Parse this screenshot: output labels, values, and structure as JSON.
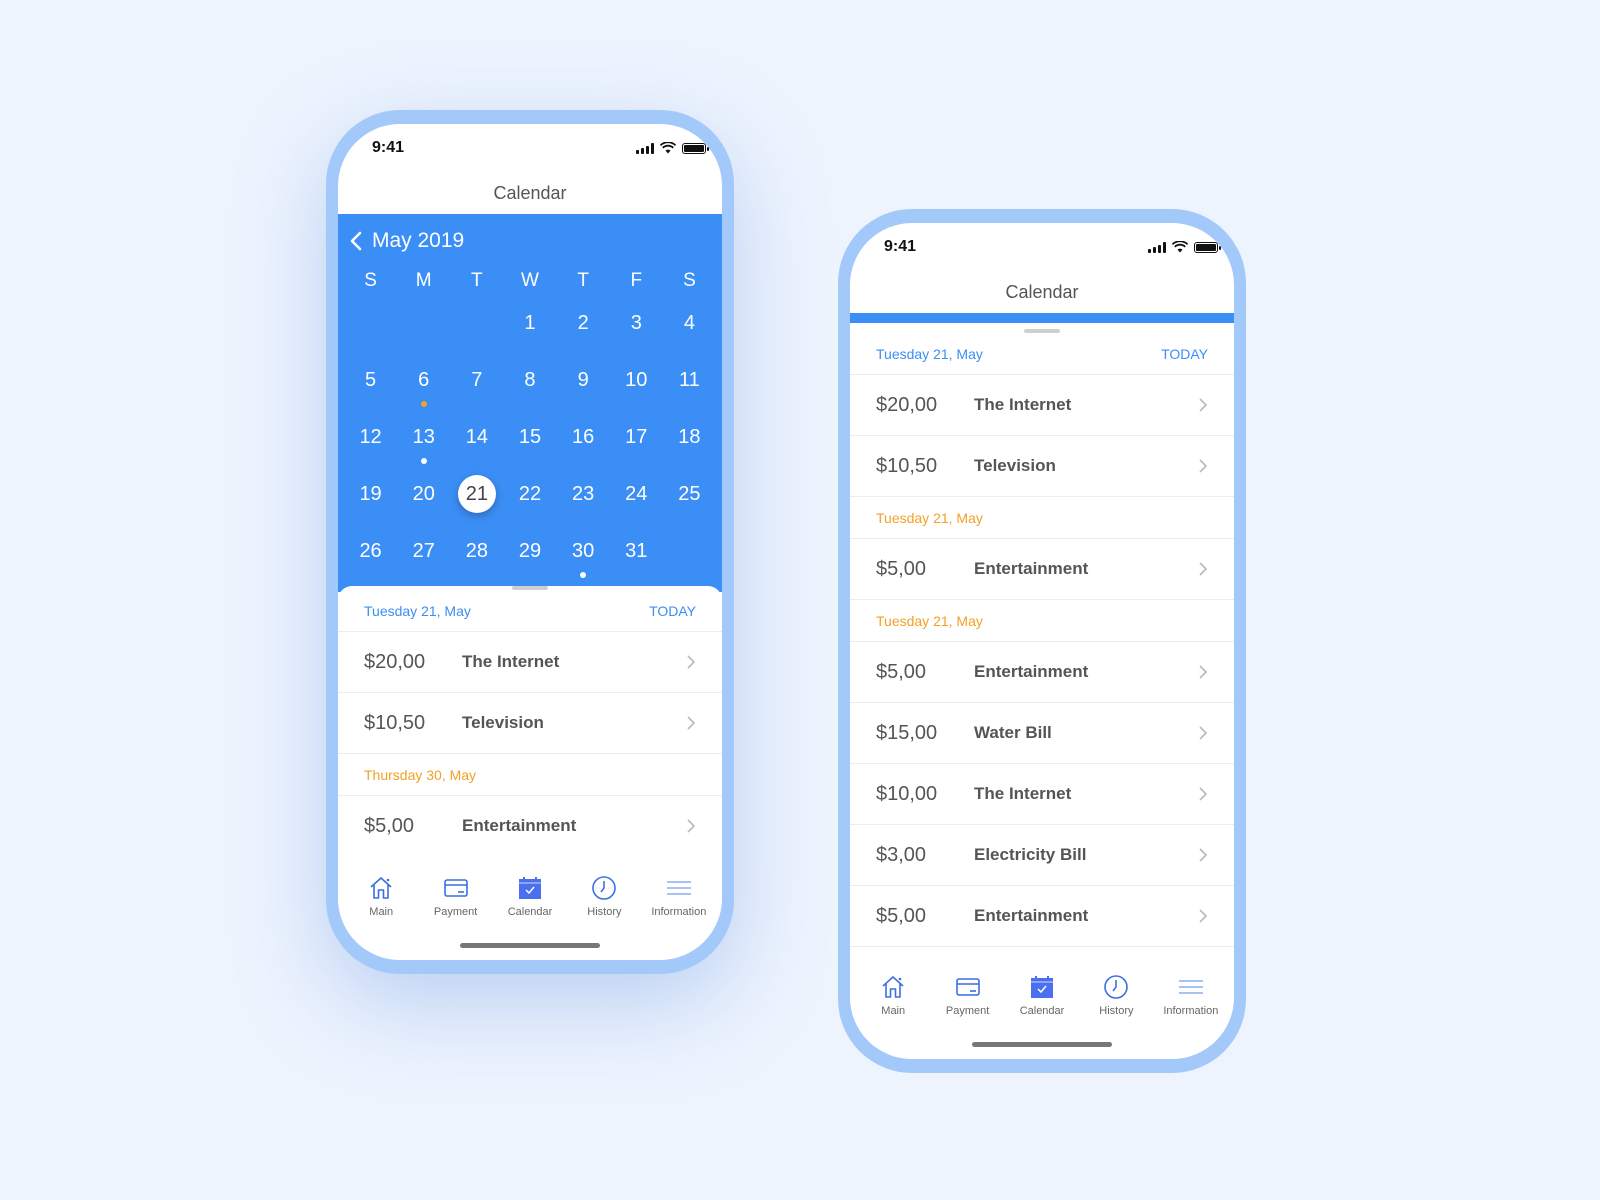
{
  "colors": {
    "accent": "#3b8ef5",
    "orange": "#f4a024",
    "frame": "#a3c9fb",
    "background": "#eef4fe"
  },
  "phone1": {
    "status": {
      "time": "9:41"
    },
    "nav_title": "Calendar",
    "calendar": {
      "month_label": "May 2019",
      "weekdays": [
        "S",
        "M",
        "T",
        "W",
        "T",
        "F",
        "S"
      ],
      "leading_blanks": 3,
      "days": [
        "1",
        "2",
        "3",
        "4",
        "5",
        "6",
        "7",
        "8",
        "9",
        "10",
        "11",
        "12",
        "13",
        "14",
        "15",
        "16",
        "17",
        "18",
        "19",
        "20",
        "21",
        "22",
        "23",
        "24",
        "25",
        "26",
        "27",
        "28",
        "29",
        "30",
        "31"
      ],
      "selected_day": "21",
      "dots": {
        "6": "orange",
        "13": "white",
        "30": "white"
      }
    },
    "sections": [
      {
        "date": "Tuesday 21, May",
        "date_color": "accent",
        "today_label": "TODAY",
        "items": [
          {
            "amount": "$20,00",
            "name": "The Internet"
          },
          {
            "amount": "$10,50",
            "name": "Television"
          }
        ]
      },
      {
        "date": "Thursday 30, May",
        "date_color": "orange",
        "today_label": "",
        "items": [
          {
            "amount": "$5,00",
            "name": "Entertainment"
          }
        ]
      }
    ]
  },
  "phone2": {
    "status": {
      "time": "9:41"
    },
    "nav_title": "Calendar",
    "sections": [
      {
        "date": "Tuesday 21, May",
        "date_color": "accent",
        "today_label": "TODAY",
        "items": [
          {
            "amount": "$20,00",
            "name": "The Internet"
          },
          {
            "amount": "$10,50",
            "name": "Television"
          }
        ]
      },
      {
        "date": "Tuesday 21, May",
        "date_color": "orange",
        "today_label": "",
        "items": [
          {
            "amount": "$5,00",
            "name": "Entertainment"
          }
        ]
      },
      {
        "date": "Tuesday 21, May",
        "date_color": "orange",
        "today_label": "",
        "items": [
          {
            "amount": "$5,00",
            "name": "Entertainment"
          },
          {
            "amount": "$15,00",
            "name": "Water Bill"
          },
          {
            "amount": "$10,00",
            "name": "The Internet"
          },
          {
            "amount": "$3,00",
            "name": "Electricity Bill"
          },
          {
            "amount": "$5,00",
            "name": "Entertainment"
          }
        ]
      }
    ]
  },
  "tabbar": [
    {
      "label": "Main",
      "icon": "home-icon",
      "active": false
    },
    {
      "label": "Payment",
      "icon": "card-icon",
      "active": false
    },
    {
      "label": "Calendar",
      "icon": "calendar-icon",
      "active": true
    },
    {
      "label": "History",
      "icon": "clock-icon",
      "active": false
    },
    {
      "label": "Information",
      "icon": "menu-icon",
      "active": false
    }
  ]
}
